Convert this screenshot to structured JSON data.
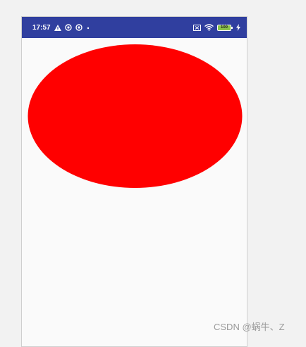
{
  "status_bar": {
    "time": "17:57",
    "battery_level": "100",
    "background_color": "#303f9f",
    "left_icons": [
      "warning-icon",
      "sync-icon",
      "sync-icon",
      "dot-icon"
    ],
    "right_icons": [
      "no-sim-icon",
      "wifi-icon",
      "battery-icon",
      "charging-icon"
    ]
  },
  "canvas": {
    "shape": "ellipse",
    "fill_color": "#ff0000",
    "background_color": "#fafafa"
  },
  "watermark": {
    "text": "CSDN @蜗牛、Z"
  }
}
